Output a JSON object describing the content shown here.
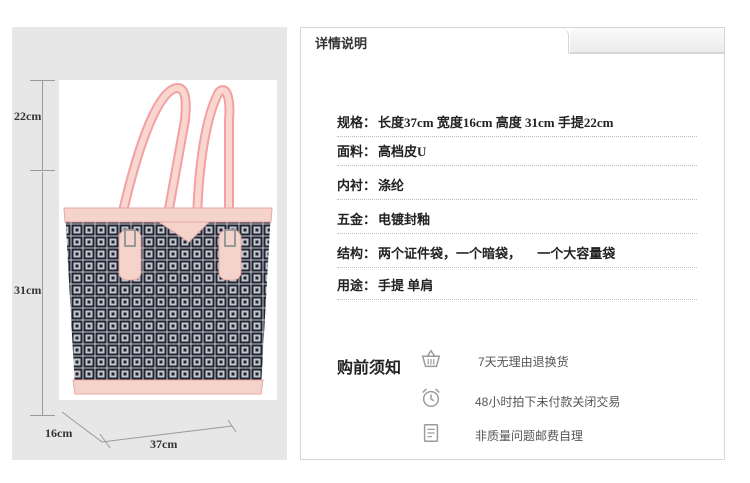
{
  "product": {
    "dimensions": {
      "handle_height": "22cm",
      "bag_height": "31cm",
      "depth": "16cm",
      "width": "37cm"
    }
  },
  "details": {
    "tab_title": "详情说明",
    "specs": [
      {
        "label": "规格：",
        "value": "长度37cm 宽度16cm 高度 31cm 手提22cm"
      },
      {
        "label": "面料：",
        "value": "高档皮U"
      },
      {
        "label": "内衬：",
        "value": "涤纶"
      },
      {
        "label": "五金：",
        "value": "电镀封釉"
      },
      {
        "label": "结构：",
        "value": "两个证件袋，一个暗袋，     一个大容量袋"
      },
      {
        "label": "用途：",
        "value": "手提 单肩"
      }
    ]
  },
  "notice": {
    "title": "购前须知",
    "items": [
      {
        "icon": "shopping-basket-icon",
        "text": "7天无理由退换货"
      },
      {
        "icon": "alarm-clock-icon",
        "text": "48小时拍下未付款关闭交易"
      },
      {
        "icon": "document-icon",
        "text": "非质量问题邮费自理"
      }
    ]
  },
  "colors": {
    "panel_gray": "#e7e7e7",
    "handle_pink": "#f2a1a3",
    "pattern_dark": "#1f2430",
    "pattern_light": "#c4c6cf"
  }
}
